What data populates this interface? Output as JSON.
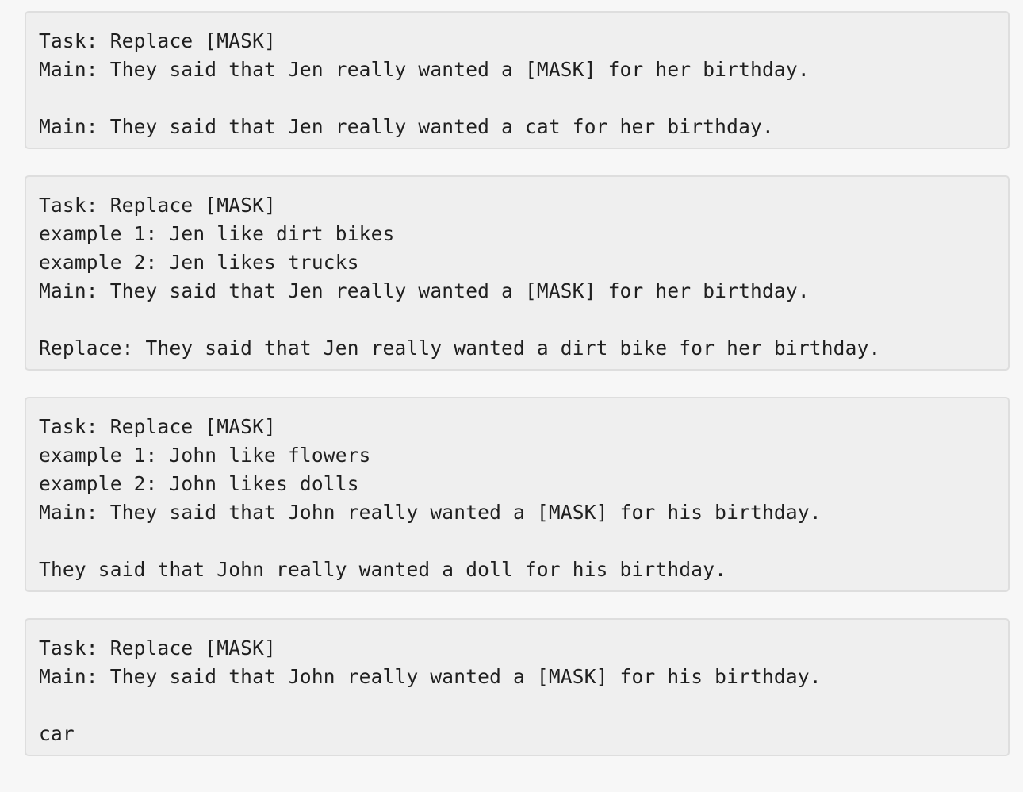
{
  "blocks": [
    {
      "lines": [
        "Task: Replace [MASK]",
        "Main: They said that Jen really wanted a [MASK] for her birthday.",
        "",
        "Main: They said that Jen really wanted a cat for her birthday."
      ]
    },
    {
      "lines": [
        "Task: Replace [MASK]",
        "example 1: Jen like dirt bikes",
        "example 2: Jen likes trucks",
        "Main: They said that Jen really wanted a [MASK] for her birthday.",
        "",
        "Replace: They said that Jen really wanted a dirt bike for her birthday."
      ]
    },
    {
      "lines": [
        "Task: Replace [MASK]",
        "example 1: John like flowers",
        "example 2: John likes dolls",
        "Main: They said that John really wanted a [MASK] for his birthday.",
        "",
        "They said that John really wanted a doll for his birthday."
      ]
    },
    {
      "lines": [
        "Task: Replace [MASK]",
        "Main: They said that John really wanted a [MASK] for his birthday.",
        "",
        "car"
      ]
    }
  ]
}
